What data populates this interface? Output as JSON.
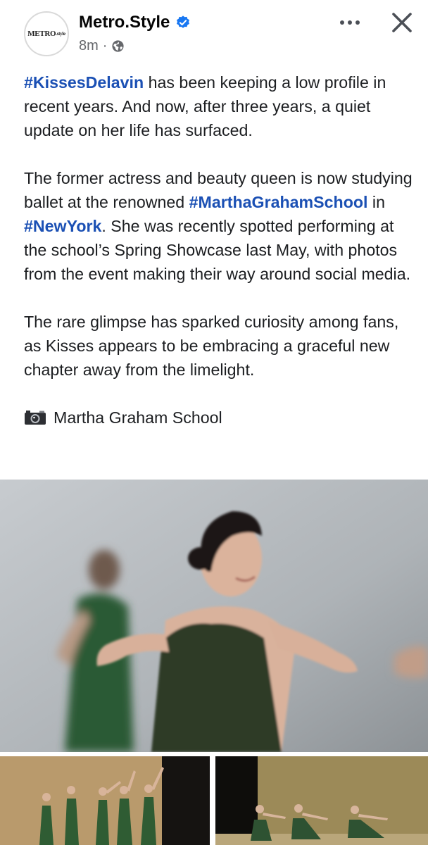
{
  "post": {
    "page_name": "Metro.Style",
    "avatar_text_main": "METRO",
    "avatar_text_sub": ".style",
    "time": "8m",
    "separator": "·",
    "icons": {
      "verified": "verified-badge-icon",
      "audience": "globe-icon",
      "more": "more-options-icon",
      "close": "close-icon",
      "camera": "camera-icon"
    },
    "colors": {
      "hashtag": "#1b50b4",
      "verified": "#1877f2",
      "meta": "#65676b"
    },
    "paragraph1": {
      "tag": "#KissesDelavin",
      "text": " has been keeping a low profile in recent years. And now, after three years, a quiet update on her life has surfaced."
    },
    "paragraph2": {
      "text_a": "The former actress and beauty queen is now studying ballet at the renowned ",
      "tag_a": "#MarthaGrahamSchool",
      "text_b": " in ",
      "tag_b": "#NewYork",
      "text_c": ". She was recently spotted performing at the school’s Spring Showcase last May, with photos from the event making their way around social media."
    },
    "paragraph3": {
      "text": "The rare glimpse has sparked curiosity among fans, as Kisses appears to be embracing a graceful new chapter away from the limelight."
    },
    "credit": "Martha Graham School"
  }
}
